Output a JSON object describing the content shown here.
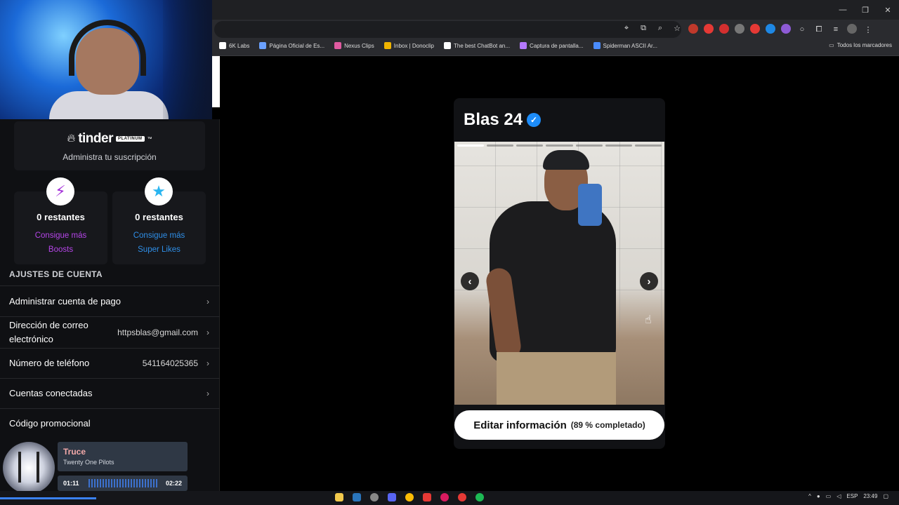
{
  "browser": {
    "bookmarks": [
      {
        "label": "6K Labs",
        "color": "#ffffff"
      },
      {
        "label": "Página Oficial de Es...",
        "color": "#6aa0ff"
      },
      {
        "label": "Nexus Clips",
        "color": "#e05aa0"
      },
      {
        "label": "Inbox | Donoclip",
        "color": "#f0b400"
      },
      {
        "label": "The best ChatBot an...",
        "color": "#ffffff"
      },
      {
        "label": "Captura de pantalla...",
        "color": "#b478ff"
      },
      {
        "label": "Spiderman ASCII Ar...",
        "color": "#4a8cff"
      }
    ],
    "all_bookmarks": "Todos los marcadores"
  },
  "sidebar": {
    "brand": "tinder",
    "brand_badge": "PLATINUM",
    "brand_tm": "™",
    "subscription": "Administra tu suscripción",
    "boosts": {
      "remaining": "0 restantes",
      "line1": "Consigue más",
      "line2": "Boosts"
    },
    "superlikes": {
      "remaining": "0 restantes",
      "line1": "Consigue más",
      "line2": "Super Likes"
    },
    "section_title": "AJUSTES DE CUENTA",
    "rows": {
      "payment": "Administrar cuenta de pago",
      "email_label": "Dirección de correo electrónico",
      "email_value": "httpsblas@gmail.com",
      "phone_label": "Número de teléfono",
      "phone_value": "541164025365",
      "connected": "Cuentas conectadas",
      "promo": "Código promocional"
    }
  },
  "music": {
    "title": "Truce",
    "artist": "Twenty One Pilots",
    "elapsed": "01:11",
    "duration": "02:22"
  },
  "profile": {
    "name": "Blas 24",
    "photo_count": 7,
    "active_photo": 1,
    "edit_label": "Editar información",
    "edit_progress": "(89 % completado)"
  },
  "taskbar": {
    "language": "ESP",
    "time": "23:49"
  },
  "colors": {
    "boost": "#a22dd8",
    "superlike": "#2ab5f0",
    "verified": "#1d8cf8"
  }
}
